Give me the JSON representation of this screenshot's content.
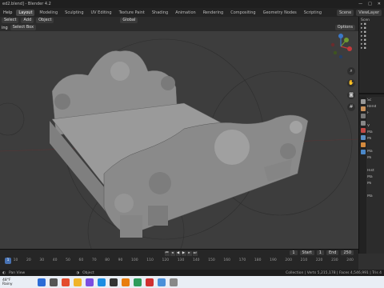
{
  "window": {
    "title": "ed2.blend] - Blender 4.2",
    "controls": [
      "—",
      "□",
      "✕"
    ]
  },
  "menubar": {
    "items": [
      "Help"
    ],
    "workspaces": [
      "Layout",
      "Modeling",
      "Sculpting",
      "UV Editing",
      "Texture Paint",
      "Shading",
      "Animation",
      "Rendering",
      "Compositing",
      "Geometry Nodes",
      "Scripting"
    ],
    "active_workspace": "Layout",
    "scene": "Scene",
    "view_layer": "ViewLayer"
  },
  "toolbar": {
    "select": "Select",
    "add": "Add",
    "object": "Object",
    "transform_orientation": "Global"
  },
  "header2": {
    "mode": "ing",
    "select_box": "Select Box",
    "options": "Options"
  },
  "timeline": {
    "playback": "Playback",
    "keying": "Keying",
    "view": "View",
    "marker": "Marker",
    "current_frame": "1",
    "start_label": "Start",
    "start": "1",
    "end_label": "End",
    "end": "250",
    "ruler": [
      "10",
      "20",
      "30",
      "40",
      "50",
      "60",
      "70",
      "80",
      "90",
      "100",
      "110",
      "120",
      "130",
      "140",
      "150",
      "160",
      "170",
      "180",
      "190",
      "200",
      "210",
      "220",
      "230",
      "240"
    ]
  },
  "statusbar": {
    "pan_view": "Pan View",
    "context_menu": "Object",
    "stats": "Collection | Verts 5,215,178 | Faces 4,546,991 | Tris 4"
  },
  "properties": {
    "lines": [
      "Sc",
      "Rend",
      "F",
      "",
      "V",
      "Ma",
      "Mi",
      "",
      "Ma",
      "Mi",
      "",
      "Hist",
      "Ma",
      "Mi",
      "",
      "Ma"
    ]
  },
  "outliner": {
    "title": "Scen"
  },
  "taskbar": {
    "weather_temp": "48°F",
    "weather_desc": "Rainy"
  },
  "colors": {
    "accent": "#4772b3",
    "viewport": "#3d3d3d",
    "x_axis": "#c3393c",
    "y_axis": "#6f9a2e",
    "z_axis": "#3b78c8"
  }
}
